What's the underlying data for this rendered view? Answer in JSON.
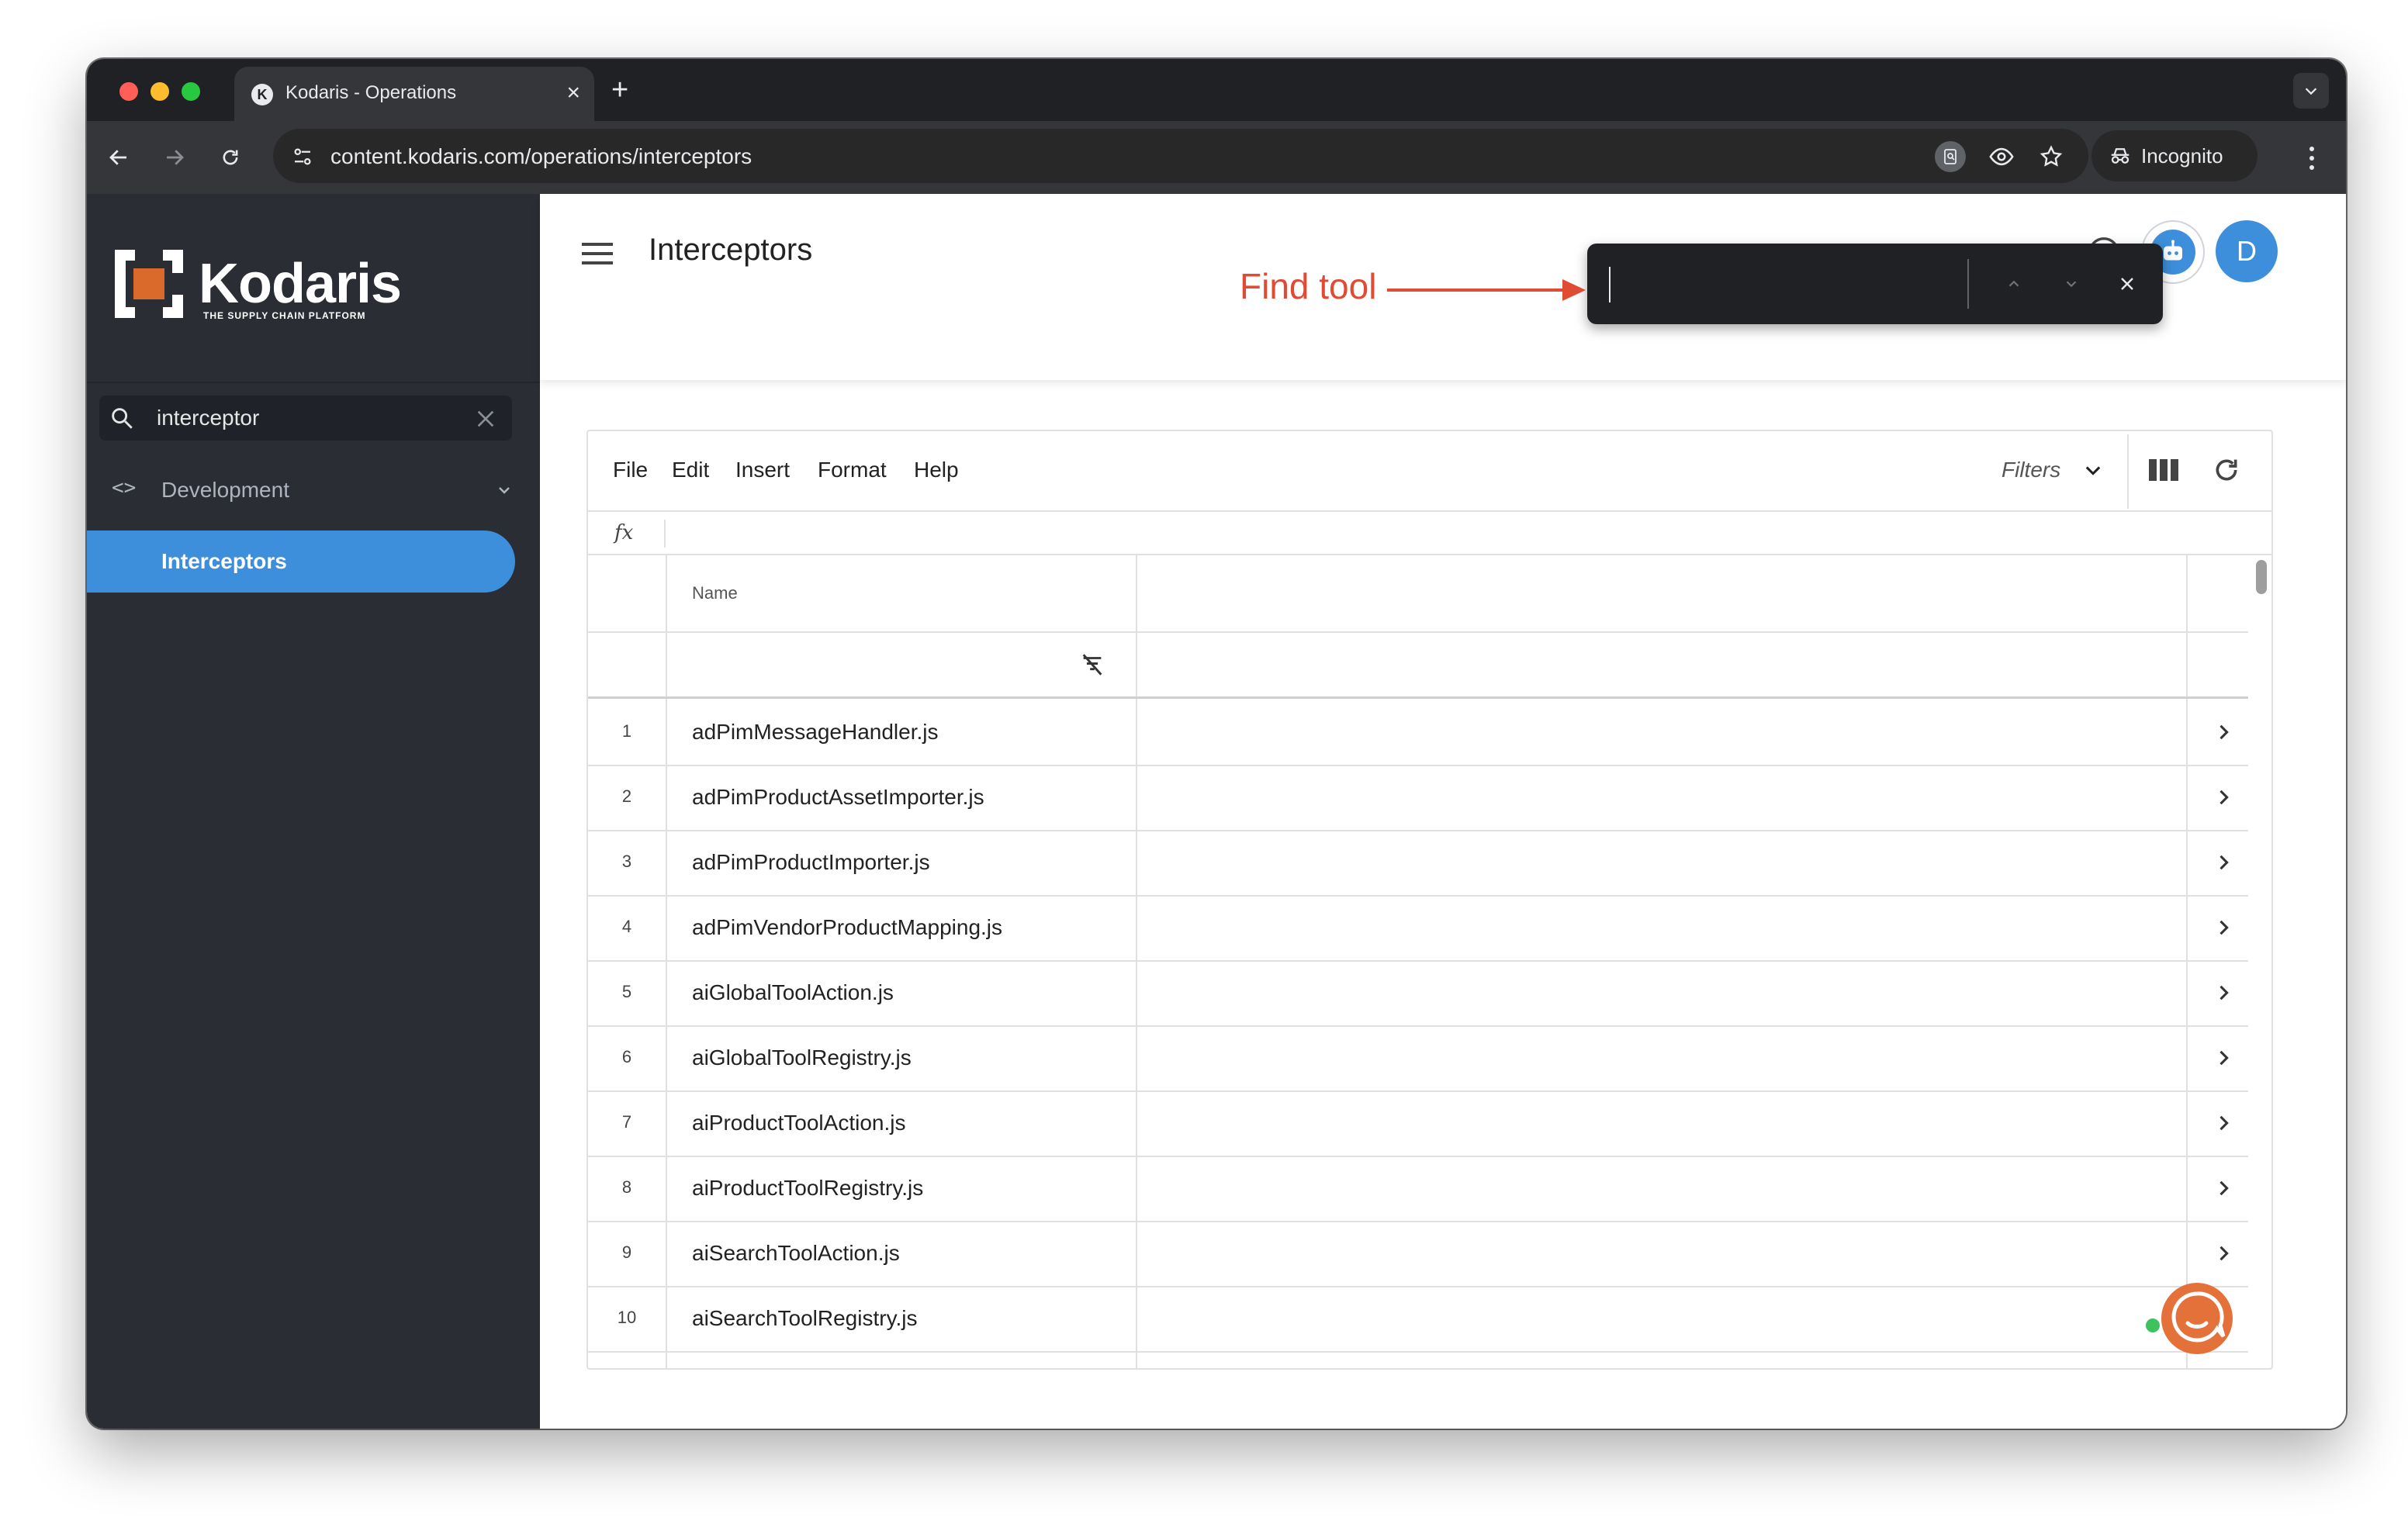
{
  "browser": {
    "tab_title": "Kodaris - Operations",
    "tab_close": "×",
    "new_tab": "+",
    "url": "content.kodaris.com/operations/interceptors",
    "incognito_label": "Incognito"
  },
  "sidebar": {
    "logo_text": "Kodaris",
    "logo_tagline": "THE SUPPLY CHAIN PLATFORM",
    "search_value": "interceptor",
    "group_icon": "<>",
    "group_label": "Development",
    "active_item": "Interceptors"
  },
  "header": {
    "title": "Interceptors",
    "avatar_initial": "D"
  },
  "find_bar": {
    "value": ""
  },
  "annotation": {
    "label": "Find tool",
    "color": "#e04b34"
  },
  "grid": {
    "menu": [
      "File",
      "Edit",
      "Insert",
      "Format",
      "Help"
    ],
    "filters_label": "Filters",
    "fx_label": "fx",
    "column_header": "Name",
    "rows": [
      {
        "num": "1",
        "name": "adPimMessageHandler.js"
      },
      {
        "num": "2",
        "name": "adPimProductAssetImporter.js"
      },
      {
        "num": "3",
        "name": "adPimProductImporter.js"
      },
      {
        "num": "4",
        "name": "adPimVendorProductMapping.js"
      },
      {
        "num": "5",
        "name": "aiGlobalToolAction.js"
      },
      {
        "num": "6",
        "name": "aiGlobalToolRegistry.js"
      },
      {
        "num": "7",
        "name": "aiProductToolAction.js"
      },
      {
        "num": "8",
        "name": "aiProductToolRegistry.js"
      },
      {
        "num": "9",
        "name": "aiSearchToolAction.js"
      },
      {
        "num": "10",
        "name": "aiSearchToolRegistry.js"
      }
    ]
  },
  "colors": {
    "accent": "#3e8fdb",
    "sidebar_bg": "#2a2d34",
    "chrome_dark": "#202124"
  }
}
